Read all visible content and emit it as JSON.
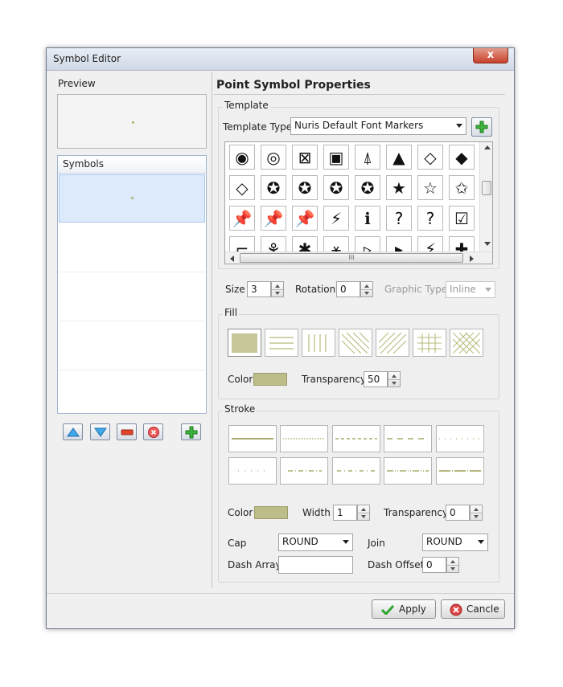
{
  "window": {
    "title": "Symbol Editor",
    "close_symbol": "x"
  },
  "left": {
    "preview_label": "Preview",
    "symbols_label": "Symbols"
  },
  "main": {
    "heading": "Point Symbol Properties",
    "template": {
      "group_label": "Template",
      "type_label": "Template Type",
      "type_value": "Nuris Default Font Markers",
      "hscroll_grip": "III"
    },
    "glyph_rows": [
      [
        "◉",
        "◎",
        "⊠",
        "▣",
        "⍋",
        "▲",
        "◇",
        "◆"
      ],
      [
        "◇",
        "✪",
        "✪",
        "✪",
        "✪",
        "★",
        "☆",
        "✩"
      ],
      [
        "📌",
        "📌",
        "📌",
        "⚡",
        "ℹ",
        "?",
        "?",
        "☑"
      ],
      [
        "⌐",
        "⚘",
        "✱",
        "⚹",
        "▹",
        "▸",
        "⚡",
        "✚"
      ]
    ],
    "size_label": "Size",
    "size_value": "3",
    "rotation_label": "Rotation",
    "rotation_value": "0",
    "graphic_type_label": "Graphic Type",
    "graphic_type_value": "Inline",
    "fill": {
      "group_label": "Fill",
      "color_label": "Color",
      "color": "#bcbd88",
      "transparency_label": "Transparency",
      "transparency_value": "50"
    },
    "stroke": {
      "group_label": "Stroke",
      "color_label": "Color",
      "color": "#bcbd88",
      "width_label": "Width",
      "width_value": "1",
      "transparency_label": "Transparency",
      "transparency_value": "0",
      "cap_label": "Cap",
      "cap_value": "ROUND",
      "join_label": "Join",
      "join_value": "ROUND",
      "dash_array_label": "Dash Array",
      "dash_array_value": "",
      "dash_offset_label": "Dash Offset",
      "dash_offset_value": "0"
    }
  },
  "footer": {
    "apply_label": "Apply",
    "cancel_label": "Cancle"
  },
  "colors": {
    "accent_olive": "#a8b46a",
    "selection": "#dceafc"
  }
}
